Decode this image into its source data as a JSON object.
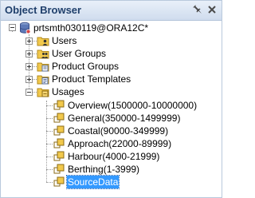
{
  "panel": {
    "title": "Object Browser",
    "pin_icon": "pin-icon",
    "close_icon": "close-icon"
  },
  "tree": {
    "root": {
      "label": "prtsmth030119@ORA12C*",
      "icon": "database-icon",
      "expanded": true
    },
    "groups": [
      {
        "label": "Users",
        "icon": "users-folder-icon",
        "expanded": false
      },
      {
        "label": "User Groups",
        "icon": "user-groups-folder-icon",
        "expanded": false
      },
      {
        "label": "Product Groups",
        "icon": "product-groups-folder-icon",
        "expanded": false
      },
      {
        "label": "Product Templates",
        "icon": "product-templates-folder-icon",
        "expanded": false
      },
      {
        "label": "Usages",
        "icon": "usages-folder-icon",
        "expanded": true
      }
    ],
    "usages": [
      {
        "label": "Overview(1500000-10000000)",
        "icon": "usage-icon"
      },
      {
        "label": "General(350000-1499999)",
        "icon": "usage-icon"
      },
      {
        "label": "Coastal(90000-349999)",
        "icon": "usage-icon"
      },
      {
        "label": "Approach(22000-89999)",
        "icon": "usage-icon"
      },
      {
        "label": "Harbour(4000-21999)",
        "icon": "usage-icon"
      },
      {
        "label": "Berthing(1-3999)",
        "icon": "usage-icon"
      },
      {
        "label": "SourceData",
        "icon": "usage-icon",
        "selected": true
      }
    ]
  },
  "colors": {
    "title_text": "#1f3f6b",
    "selection_bg": "#3399ff",
    "folder": "#f2c94c"
  }
}
